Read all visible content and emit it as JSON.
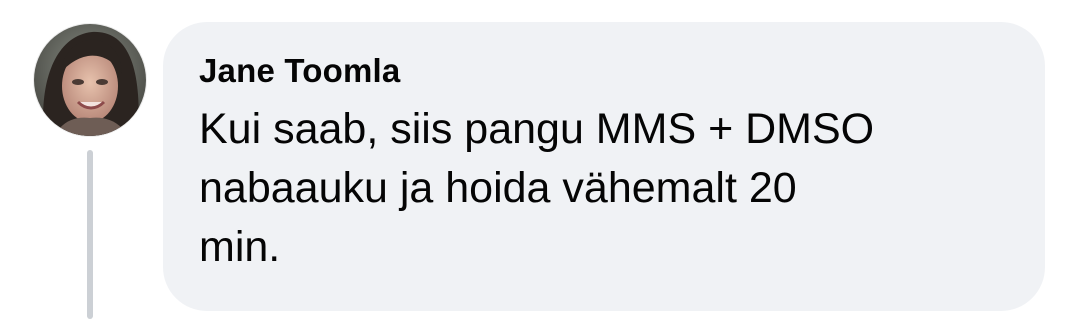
{
  "comment": {
    "author": "Jane Toomla",
    "avatar_icon": "profile-photo",
    "text_lines": [
      "Kui saab, siis pangu MMS + DMSO",
      "nabaauku ja hoida vähemalt 20",
      "min."
    ],
    "bubble_color": "#f0f2f5",
    "text_color": "#050505",
    "thread_line_color": "#ccd0d5"
  }
}
